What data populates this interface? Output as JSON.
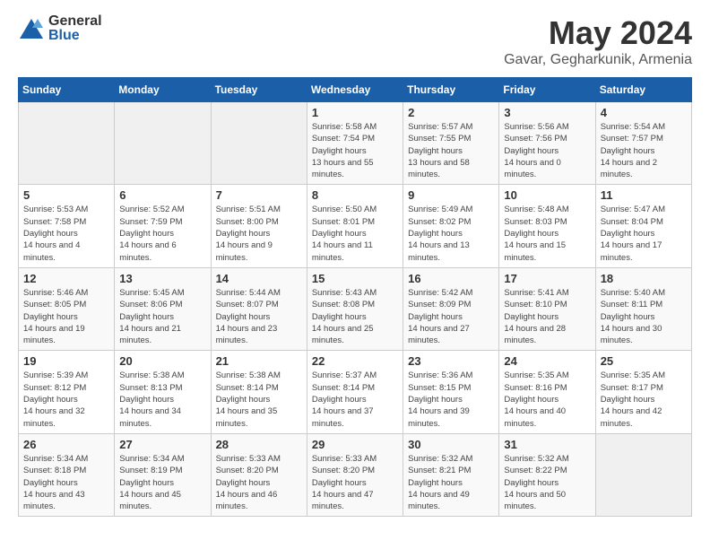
{
  "logo": {
    "general": "General",
    "blue": "Blue"
  },
  "header": {
    "month": "May 2024",
    "location": "Gavar, Gegharkunik, Armenia"
  },
  "weekdays": [
    "Sunday",
    "Monday",
    "Tuesday",
    "Wednesday",
    "Thursday",
    "Friday",
    "Saturday"
  ],
  "weeks": [
    [
      {
        "day": "",
        "empty": true
      },
      {
        "day": "",
        "empty": true
      },
      {
        "day": "",
        "empty": true
      },
      {
        "day": "1",
        "sunrise": "5:58 AM",
        "sunset": "7:54 PM",
        "daylight": "13 hours and 55 minutes."
      },
      {
        "day": "2",
        "sunrise": "5:57 AM",
        "sunset": "7:55 PM",
        "daylight": "13 hours and 58 minutes."
      },
      {
        "day": "3",
        "sunrise": "5:56 AM",
        "sunset": "7:56 PM",
        "daylight": "14 hours and 0 minutes."
      },
      {
        "day": "4",
        "sunrise": "5:54 AM",
        "sunset": "7:57 PM",
        "daylight": "14 hours and 2 minutes."
      }
    ],
    [
      {
        "day": "5",
        "sunrise": "5:53 AM",
        "sunset": "7:58 PM",
        "daylight": "14 hours and 4 minutes."
      },
      {
        "day": "6",
        "sunrise": "5:52 AM",
        "sunset": "7:59 PM",
        "daylight": "14 hours and 6 minutes."
      },
      {
        "day": "7",
        "sunrise": "5:51 AM",
        "sunset": "8:00 PM",
        "daylight": "14 hours and 9 minutes."
      },
      {
        "day": "8",
        "sunrise": "5:50 AM",
        "sunset": "8:01 PM",
        "daylight": "14 hours and 11 minutes."
      },
      {
        "day": "9",
        "sunrise": "5:49 AM",
        "sunset": "8:02 PM",
        "daylight": "14 hours and 13 minutes."
      },
      {
        "day": "10",
        "sunrise": "5:48 AM",
        "sunset": "8:03 PM",
        "daylight": "14 hours and 15 minutes."
      },
      {
        "day": "11",
        "sunrise": "5:47 AM",
        "sunset": "8:04 PM",
        "daylight": "14 hours and 17 minutes."
      }
    ],
    [
      {
        "day": "12",
        "sunrise": "5:46 AM",
        "sunset": "8:05 PM",
        "daylight": "14 hours and 19 minutes."
      },
      {
        "day": "13",
        "sunrise": "5:45 AM",
        "sunset": "8:06 PM",
        "daylight": "14 hours and 21 minutes."
      },
      {
        "day": "14",
        "sunrise": "5:44 AM",
        "sunset": "8:07 PM",
        "daylight": "14 hours and 23 minutes."
      },
      {
        "day": "15",
        "sunrise": "5:43 AM",
        "sunset": "8:08 PM",
        "daylight": "14 hours and 25 minutes."
      },
      {
        "day": "16",
        "sunrise": "5:42 AM",
        "sunset": "8:09 PM",
        "daylight": "14 hours and 27 minutes."
      },
      {
        "day": "17",
        "sunrise": "5:41 AM",
        "sunset": "8:10 PM",
        "daylight": "14 hours and 28 minutes."
      },
      {
        "day": "18",
        "sunrise": "5:40 AM",
        "sunset": "8:11 PM",
        "daylight": "14 hours and 30 minutes."
      }
    ],
    [
      {
        "day": "19",
        "sunrise": "5:39 AM",
        "sunset": "8:12 PM",
        "daylight": "14 hours and 32 minutes."
      },
      {
        "day": "20",
        "sunrise": "5:38 AM",
        "sunset": "8:13 PM",
        "daylight": "14 hours and 34 minutes."
      },
      {
        "day": "21",
        "sunrise": "5:38 AM",
        "sunset": "8:14 PM",
        "daylight": "14 hours and 35 minutes."
      },
      {
        "day": "22",
        "sunrise": "5:37 AM",
        "sunset": "8:14 PM",
        "daylight": "14 hours and 37 minutes."
      },
      {
        "day": "23",
        "sunrise": "5:36 AM",
        "sunset": "8:15 PM",
        "daylight": "14 hours and 39 minutes."
      },
      {
        "day": "24",
        "sunrise": "5:35 AM",
        "sunset": "8:16 PM",
        "daylight": "14 hours and 40 minutes."
      },
      {
        "day": "25",
        "sunrise": "5:35 AM",
        "sunset": "8:17 PM",
        "daylight": "14 hours and 42 minutes."
      }
    ],
    [
      {
        "day": "26",
        "sunrise": "5:34 AM",
        "sunset": "8:18 PM",
        "daylight": "14 hours and 43 minutes."
      },
      {
        "day": "27",
        "sunrise": "5:34 AM",
        "sunset": "8:19 PM",
        "daylight": "14 hours and 45 minutes."
      },
      {
        "day": "28",
        "sunrise": "5:33 AM",
        "sunset": "8:20 PM",
        "daylight": "14 hours and 46 minutes."
      },
      {
        "day": "29",
        "sunrise": "5:33 AM",
        "sunset": "8:20 PM",
        "daylight": "14 hours and 47 minutes."
      },
      {
        "day": "30",
        "sunrise": "5:32 AM",
        "sunset": "8:21 PM",
        "daylight": "14 hours and 49 minutes."
      },
      {
        "day": "31",
        "sunrise": "5:32 AM",
        "sunset": "8:22 PM",
        "daylight": "14 hours and 50 minutes."
      },
      {
        "day": "",
        "empty": true
      }
    ]
  ]
}
